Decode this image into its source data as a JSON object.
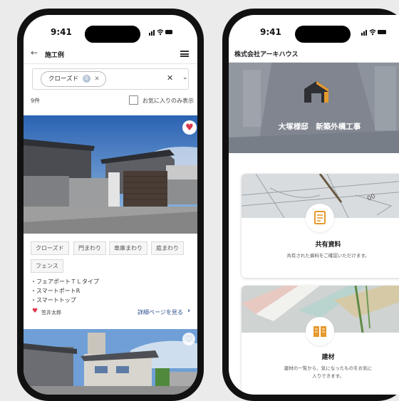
{
  "left_phone": {
    "time": "9:41",
    "header_title": "施工例",
    "filter_chip": "クローズド",
    "filter_chip_count": "0",
    "result_count": "9件",
    "favorites_only_label": "お気に入りのみ表示",
    "tags": [
      "クローズド",
      "門まわり",
      "車庫まわり",
      "庭まわり",
      "フェンス"
    ],
    "features": [
      "・フェアポートＴＬタイプ",
      "・スマートポートR",
      "・スマートトップ"
    ],
    "favorite_name": "笠井太郎",
    "detail_link": "詳細ページを見る",
    "colors": {
      "accent": "#2c4e8e",
      "heart": "#d9364a"
    }
  },
  "right_phone": {
    "time": "9:41",
    "company_name": "株式会社アーキハウス",
    "hero_title": "大塚様邸　新築外構工事",
    "cards": [
      {
        "title": "共有資料",
        "description": "共有された資料をご確認いただけます。",
        "icon": "document-icon"
      },
      {
        "title": "建材",
        "description_line1": "建材の一覧から、気になったものをお気に",
        "description_line2": "入りできます。",
        "icon": "book-icon"
      }
    ],
    "colors": {
      "icon": "#e49a2e"
    }
  }
}
